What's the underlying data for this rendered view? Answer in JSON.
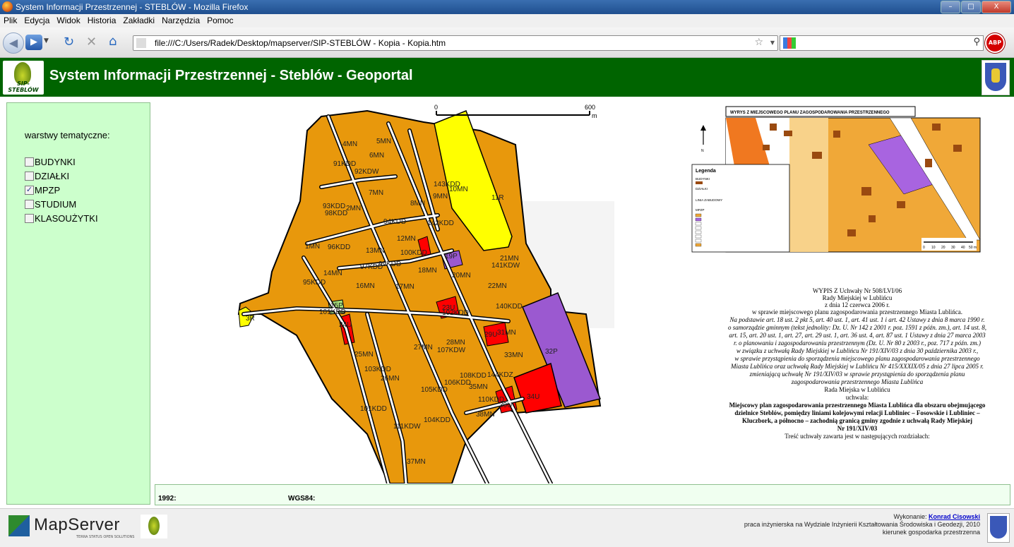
{
  "window": {
    "title": "System Informacji Przestrzennej - STEBLÓW - Mozilla Firefox",
    "minimize": "–",
    "maximize": "□",
    "close": "X"
  },
  "menu": [
    "Plik",
    "Edycja",
    "Widok",
    "Historia",
    "Zakładki",
    "Narzędzia",
    "Pomoc"
  ],
  "nav": {
    "url": "file:///C:/Users/Radek/Desktop/mapserver/SIP-STEBLÓW - Kopia - Kopia.htm",
    "search_value": "",
    "abp_label": "ABP"
  },
  "header": {
    "logo_text": "SIP-STEBLÓW",
    "title": "System Informacji Przestrzennej - Steblów - Geoportal"
  },
  "sidebar": {
    "title": "warstwy tematyczne:",
    "layers": [
      {
        "label": "BUDYNKI",
        "checked": false
      },
      {
        "label": "DZIAŁKI",
        "checked": false
      },
      {
        "label": "MPZP",
        "checked": true
      },
      {
        "label": "STUDIUM",
        "checked": false
      },
      {
        "label": "KLASOUŻYTKI",
        "checked": false
      }
    ]
  },
  "map": {
    "scale_start": "0",
    "scale_end": "600",
    "scale_unit": "m",
    "parcel_labels": [
      "4MN",
      "5MN",
      "6MN",
      "91KDD",
      "92KDW",
      "7MN",
      "10MN",
      "11R",
      "93KDD",
      "2MN",
      "8MN",
      "9MN",
      "142KDD",
      "94KDD",
      "1MN",
      "12MN",
      "19P",
      "21MN",
      "13MN",
      "99KDD",
      "17MN",
      "18MN",
      "20MN",
      "22MN",
      "14MN",
      "95KDD",
      "16MN",
      "23U",
      "24U",
      "101KDD",
      "3R",
      "28MN",
      "27MN",
      "29U",
      "31MN",
      "33MN",
      "25MN",
      "32P",
      "103KDD",
      "26MN",
      "35MN",
      "144KDZ",
      "30U",
      "34U",
      "101KDD",
      "37MN",
      "38MN",
      "111KDW",
      "102KDD",
      "104KDD",
      "107KDW",
      "105KDD",
      "106KDD",
      "110KDD",
      "100KDD",
      "140KDD",
      "141KDW",
      "143KDD",
      "108KDD",
      "15P",
      "96KDD",
      "97KDD",
      "98KDD"
    ],
    "inset_title": "WYRYS Z MIEJSCOWEGO PLANU ZAGOSPODAROWANIA PRZESTRZENNEGO",
    "inset_legend_title": "Legenda",
    "inset_legend_items": [
      "BUDYNKI",
      "DZIAŁKI",
      "LINIA ZABUDOWY",
      "MPZP"
    ],
    "inset_scale": [
      "0",
      "10",
      "20",
      "30",
      "40",
      "50 m"
    ],
    "inset_north": "N"
  },
  "resolution": {
    "lines": [
      "WYPIS Z Uchwały Nr 508/LVI/06",
      "Rady Miejskiej w Lublińcu",
      "z dnia 12 czerwca 2006 r.",
      "w sprawie miejscowego planu zagospodarowania przestrzennego Miasta Lublińca.",
      "Na podstawie art. 18 ust. 2 pkt 5, art. 40 ust. 1, art. 41 ust. 1 i art. 42 Ustawy z dnia 8 marca 1990 r.",
      "o samorządzie gminnym (tekst jednolity: Dz. U. Nr 142 z 2001 r. poz. 1591 z późn. zm.), art. 14 ust. 8,",
      "art. 15, art. 20 ust. 1, art. 27, art. 29 ust. 1, art. 36 ust. 4, art. 87 ust. 1 Ustawy z dnia 27 marca 2003",
      "r. o planowaniu i zagospodarowaniu przestrzennym (Dz. U. Nr 80 z 2003 r., poz. 717 z późn. zm.)",
      "w związku z uchwałą Rady Miejskiej w Lublińcu Nr 191/XIV/03 z dnia 30 października 2003 r.,",
      "w sprawie przystąpienia do sporządzenia miejscowego planu zagospodarowania przestrzennego",
      "Miasta Lublińca oraz uchwałą Rady Miejskiej w Lublińcu Nr 415/XXXIX/05 z dnia 27 lipca 2005 r.",
      "zmieniającą uchwałę Nr 191/XIV/03 w sprawie przystąpienia do sporządzenia planu",
      "zagospodarowania przestrzennego Miasta Lublińca",
      "Rada Miejska w Lublińcu",
      "uchwala:",
      "Miejscowy plan zagospodarowania przestrzennego Miasta Lublińca dla obszaru obejmującego",
      "dzielnice Steblów, pomiędzy liniami kolejowymi relacji Lubliniec – Fosowskie i Lubliniec –",
      "Kluczbork, a północno – zachodnią granicą gminy zgodnie z uchwałą Rady Miejskiej",
      "Nr 191/XIV/03",
      "Treść uchwały zawarta jest w następujących rozdziałach:"
    ]
  },
  "coords": {
    "label_1992": "1992:",
    "label_wgs84": "WGS84:"
  },
  "footer": {
    "mapserver": "MapServer",
    "mapserver_sub": "TERRA STATUS OPEN SOLUTIONS",
    "credit_prefix": "Wykonanie: ",
    "author": "Konrad Cisowski",
    "line2": "praca inżynierska na Wydziale Inżynierii Kształtowania Środowiska i Geodezji, 2010",
    "line3": "kierunek gospodarka przestrzenna"
  },
  "colors": {
    "header_green": "#006400",
    "sidebar_green": "#ccffcc",
    "residential": "#e8980c",
    "agricultural": "#ffff00",
    "services": "#ff0000",
    "public": "#9b59d0"
  }
}
